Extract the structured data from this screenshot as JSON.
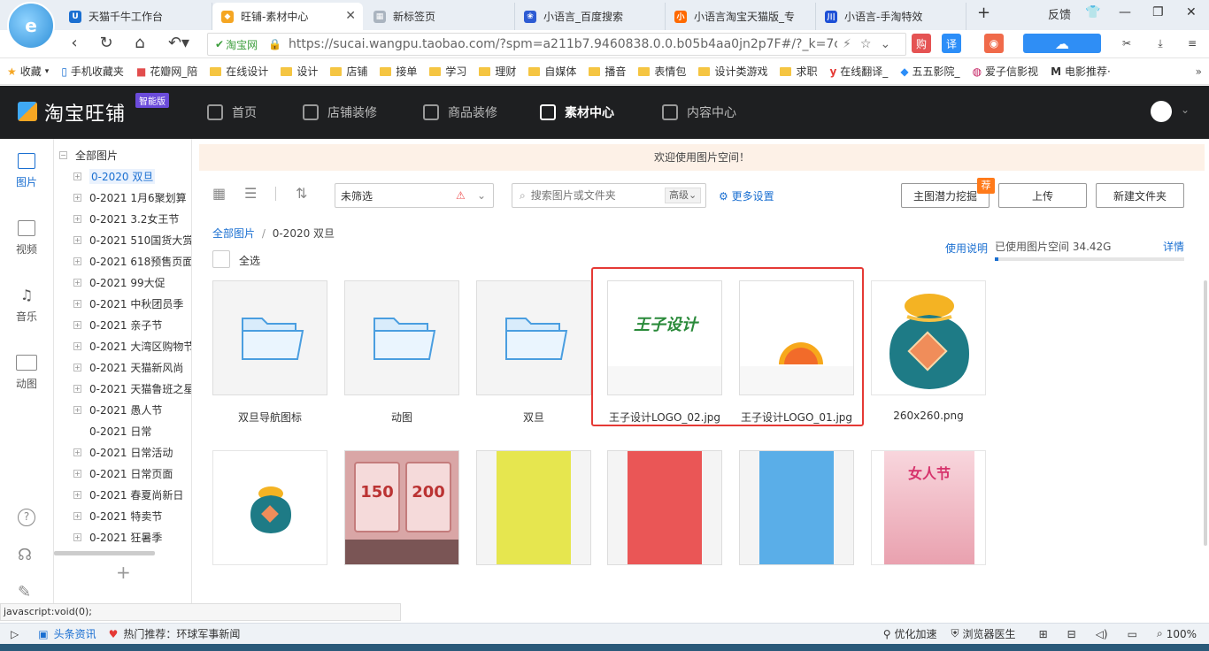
{
  "tabs": [
    {
      "title": "天猫千牛工作台",
      "color": "#1a6fd1",
      "glyph": "U"
    },
    {
      "title": "旺铺-素材中心",
      "color": "#f5a623",
      "glyph": "◆"
    },
    {
      "title": "新标签页",
      "color": "#aab4bf",
      "glyph": "▦"
    },
    {
      "title": "小语言_百度搜索",
      "color": "#2d5bd3",
      "glyph": "❀"
    },
    {
      "title": "小语言淘宝天猫版_专",
      "color": "#ff6a00",
      "glyph": "小"
    },
    {
      "title": "小语言-手淘特效",
      "color": "#1d4fd6",
      "glyph": "川"
    }
  ],
  "window": {
    "feedback": "反馈"
  },
  "address": {
    "secure_label": "淘宝网",
    "url": "https://sucai.wangpu.taobao.com/?spm=a211b7.9460838.0.0.b05b4aa0jn2p7F#/?_k=7cvw6c"
  },
  "bookmarks": [
    "收藏",
    "手机收藏夹",
    "花瓣网_陪",
    "在线设计",
    "设计",
    "店铺",
    "接单",
    "学习",
    "理财",
    "自媒体",
    "播音",
    "表情包",
    "设计类游戏",
    "求职",
    "在线翻译_",
    "五五影院_",
    "爱子信影视",
    "电影推荐·"
  ],
  "header": {
    "brand": "淘宝旺铺",
    "badge": "智能版",
    "nav": [
      "首页",
      "店铺装修",
      "商品装修",
      "素材中心",
      "内容中心"
    ],
    "active_nav": "素材中心"
  },
  "rail": [
    "图片",
    "视频",
    "音乐",
    "动图"
  ],
  "tree": {
    "root": "全部图片",
    "items": [
      "0-2020 双旦",
      "0-2021 1月6聚划算",
      "0-2021 3.2女王节",
      "0-2021 510国货大赏",
      "0-2021 618预售页面",
      "0-2021 99大促",
      "0-2021 中秋团员季",
      "0-2021 亲子节",
      "0-2021 大湾区购物节",
      "0-2021 天猫新风尚",
      "0-2021 天猫鲁班之星",
      "0-2021 愚人节",
      "0-2021 日常",
      "0-2021 日常活动",
      "0-2021 日常页面",
      "0-2021 春夏尚新日",
      "0-2021 特卖节",
      "0-2021 狂暑季"
    ],
    "add": "+"
  },
  "main": {
    "welcome": "欢迎使用图片空间！",
    "filter_value": "未筛选",
    "search_placeholder": "搜索图片或文件夹",
    "advanced": "高级",
    "more_settings": "更多设置",
    "btn_mining": "主图潜力挖掘",
    "btn_mining_tag": "荐",
    "btn_upload": "上传",
    "btn_newfolder": "新建文件夹",
    "breadcrumb_root": "全部图片",
    "breadcrumb_sep": "/",
    "breadcrumb_current": "0-2020 双旦",
    "select_all": "全选",
    "usage_help": "使用说明",
    "space_used": "已使用图片空间 34.42G",
    "details": "详情",
    "space_fraction": 0.02
  },
  "files_row1": [
    "双旦导航图标",
    "动图",
    "双旦",
    "王子设计LOGO_02.jpg",
    "王子设计LOGO_01.jpg",
    "260x260.png"
  ],
  "thumb_texts": {
    "logo": "王子设计",
    "coupon1": "150",
    "coupon2": "200",
    "poster": "女人节"
  },
  "status": {
    "tip": "javascript:void(0);",
    "news_label": "头条资讯",
    "hot": "热门推荐：环球军事新闻",
    "speed": "优化加速",
    "doctor": "浏览器医生",
    "zoom": "100%"
  }
}
